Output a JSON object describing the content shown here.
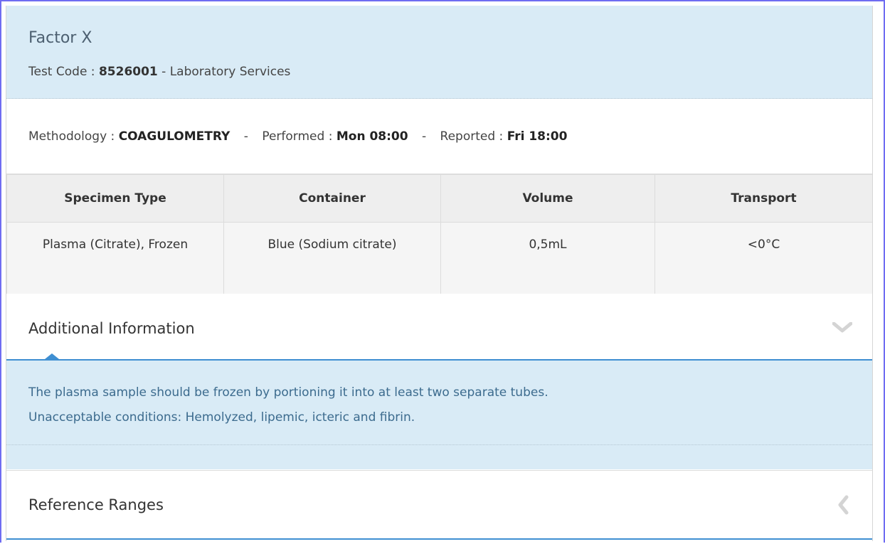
{
  "test": {
    "name": "Factor X",
    "code_label": "Test Code :",
    "code": "8526001",
    "code_suffix": "- Laboratory Services"
  },
  "method": {
    "methodology_label": "Methodology :",
    "methodology": "COAGULOMETRY",
    "separator": "-",
    "performed_label": "Performed :",
    "performed": "Mon 08:00",
    "reported_label": "Reported :",
    "reported": "Fri 18:00"
  },
  "specimen_table": {
    "headers": [
      "Specimen Type",
      "Container",
      "Volume",
      "Transport"
    ],
    "rows": [
      [
        "Plasma (Citrate), Frozen",
        "Blue (Sodium citrate)",
        "0,5mL",
        "<0°C"
      ]
    ]
  },
  "additional_info": {
    "title": "Additional Information",
    "expanded": true,
    "icon": "chevron-down-icon",
    "lines": [
      "The plasma sample should be frozen by portioning it into at least two separate tubes.",
      "Unacceptable conditions: Hemolyzed, lipemic, icteric and fibrin."
    ]
  },
  "reference_ranges": {
    "title": "Reference Ranges",
    "expanded": false,
    "icon": "chevron-left-icon"
  },
  "colors": {
    "header_bg": "#d9ebf6",
    "accent": "#3f8fd2",
    "frame": "#6f6cf2",
    "info_text": "#3c6b8e"
  }
}
